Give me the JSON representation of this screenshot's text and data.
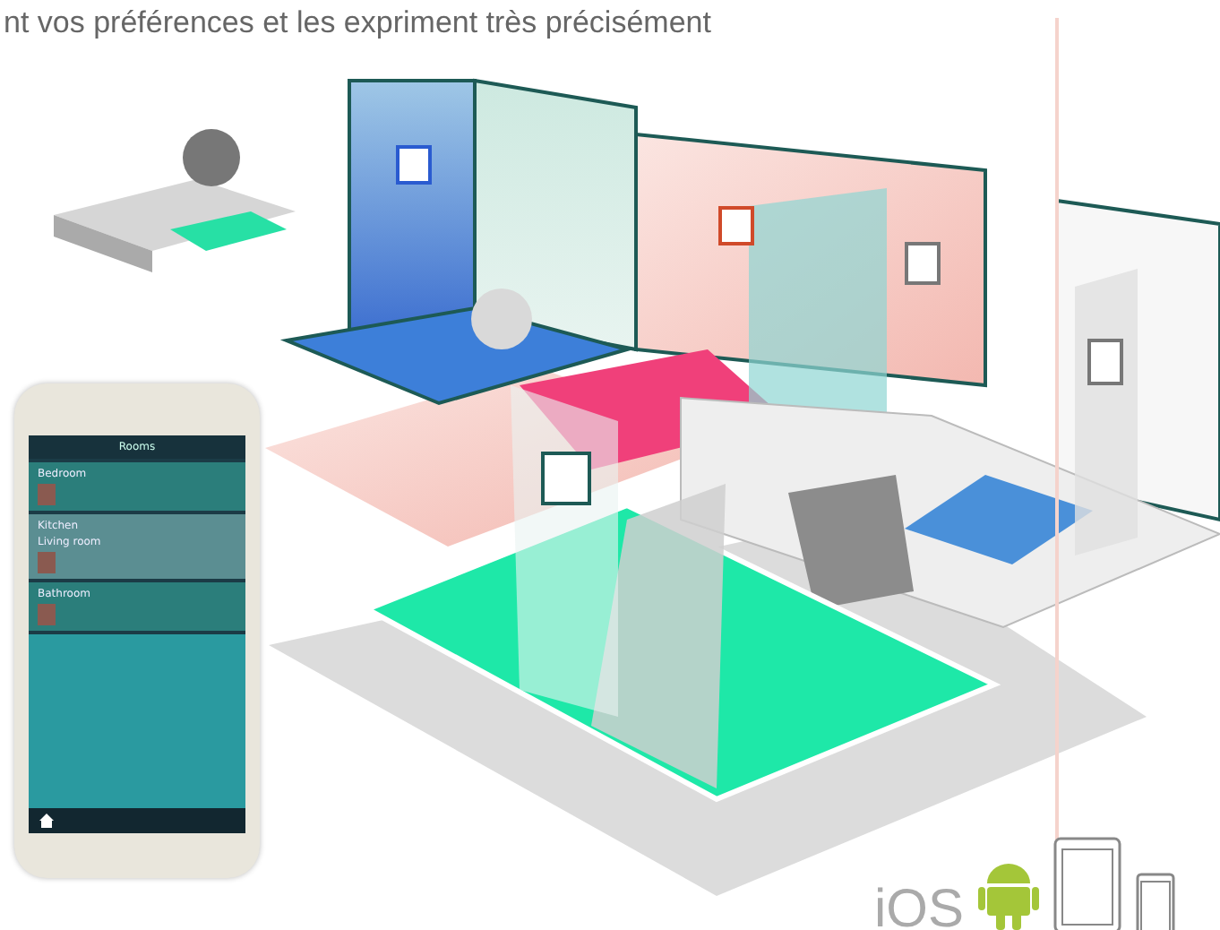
{
  "header_text": "nt vos préférences et les expriment très précisément",
  "phone": {
    "title": "Rooms",
    "rooms": [
      {
        "names": [
          "Bedroom"
        ]
      },
      {
        "names": [
          "Kitchen",
          "Living room"
        ]
      },
      {
        "names": [
          "Bathroom"
        ]
      }
    ]
  },
  "platforms": {
    "label": "iOS"
  }
}
